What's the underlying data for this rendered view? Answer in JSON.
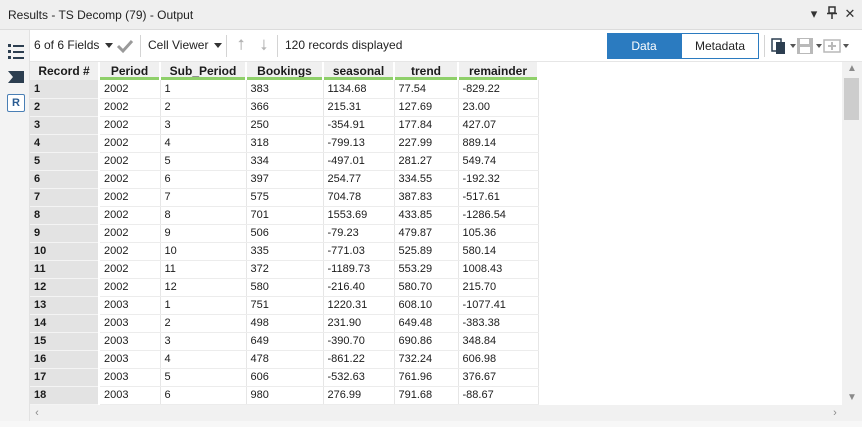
{
  "window": {
    "title": "Results - TS Decomp (79) - Output",
    "icons": [
      "dropdown-icon",
      "pin-icon",
      "close-icon"
    ]
  },
  "toolbar": {
    "fields_label": "6 of 6 Fields",
    "cell_viewer_label": "Cell Viewer",
    "records_label": "120 records displayed",
    "data_tab": "Data",
    "metadata_tab": "Metadata",
    "active_tab": "Data",
    "accent_color": "#2b7bc0"
  },
  "grid": {
    "columns": [
      "Record #",
      "Period",
      "Sub_Period",
      "Bookings",
      "seasonal",
      "trend",
      "remainder"
    ],
    "rows": [
      [
        "1",
        "2002",
        "1",
        "383",
        "1134.68",
        "77.54",
        "-829.22"
      ],
      [
        "2",
        "2002",
        "2",
        "366",
        "215.31",
        "127.69",
        "23.00"
      ],
      [
        "3",
        "2002",
        "3",
        "250",
        "-354.91",
        "177.84",
        "427.07"
      ],
      [
        "4",
        "2002",
        "4",
        "318",
        "-799.13",
        "227.99",
        "889.14"
      ],
      [
        "5",
        "2002",
        "5",
        "334",
        "-497.01",
        "281.27",
        "549.74"
      ],
      [
        "6",
        "2002",
        "6",
        "397",
        "254.77",
        "334.55",
        "-192.32"
      ],
      [
        "7",
        "2002",
        "7",
        "575",
        "704.78",
        "387.83",
        "-517.61"
      ],
      [
        "8",
        "2002",
        "8",
        "701",
        "1553.69",
        "433.85",
        "-1286.54"
      ],
      [
        "9",
        "2002",
        "9",
        "506",
        "-79.23",
        "479.87",
        "105.36"
      ],
      [
        "10",
        "2002",
        "10",
        "335",
        "-771.03",
        "525.89",
        "580.14"
      ],
      [
        "11",
        "2002",
        "11",
        "372",
        "-1189.73",
        "553.29",
        "1008.43"
      ],
      [
        "12",
        "2002",
        "12",
        "580",
        "-216.40",
        "580.70",
        "215.70"
      ],
      [
        "13",
        "2003",
        "1",
        "751",
        "1220.31",
        "608.10",
        "-1077.41"
      ],
      [
        "14",
        "2003",
        "2",
        "498",
        "231.90",
        "649.48",
        "-383.38"
      ],
      [
        "15",
        "2003",
        "3",
        "649",
        "-390.70",
        "690.86",
        "348.84"
      ],
      [
        "16",
        "2003",
        "4",
        "478",
        "-861.22",
        "732.24",
        "606.98"
      ],
      [
        "17",
        "2003",
        "5",
        "606",
        "-532.63",
        "761.96",
        "376.67"
      ],
      [
        "18",
        "2003",
        "6",
        "980",
        "276.99",
        "791.68",
        "-88.67"
      ]
    ]
  }
}
